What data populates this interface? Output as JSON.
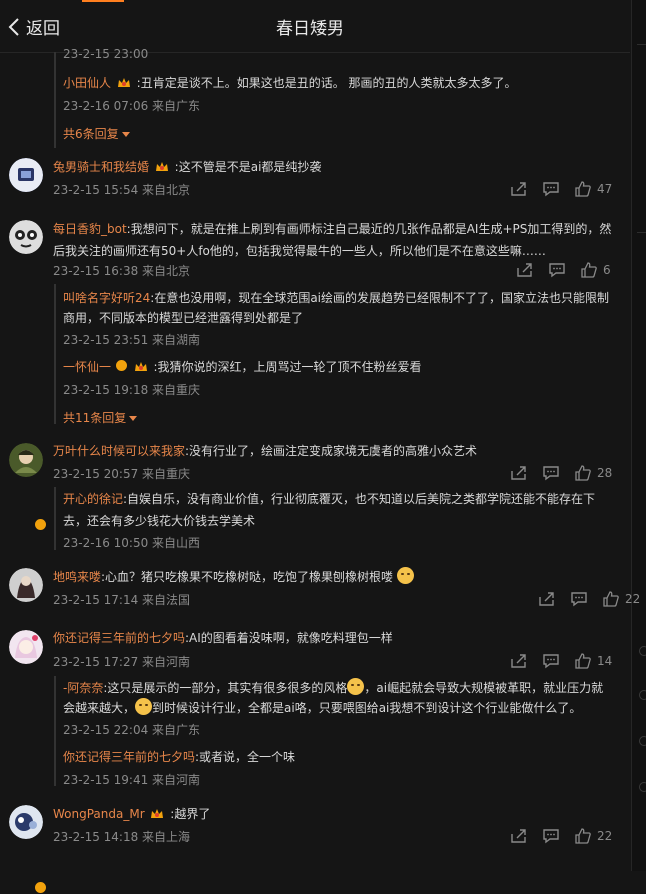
{
  "header": {
    "back_label": "返回",
    "title": "春日矮男"
  },
  "c0": {
    "meta": "23-2-15 23:00",
    "reply1": {
      "user": "小田仙人",
      "text": ":丑肯定是谈不上。如果这也是丑的话。 那画的丑的人类就太多太多了。",
      "meta": "23-2-16 07:06 来自广东"
    },
    "more": "共6条回复"
  },
  "c1": {
    "user": "兔男骑士和我结婚",
    "text": ":这不管是不是ai都是纯抄袭",
    "meta": "23-2-15 15:54 来自北京",
    "likes": "47"
  },
  "c2": {
    "user": "每日香豹_bot",
    "text1": ":我想问下，就是在推上刷到有画师标注自己最近的几张作品都是AI生成+PS加工得到的，然",
    "text2": "后我关注的画师还有50+人fo他的，包括我觉得最牛的一些人，所以他们是不在意这些嘛……",
    "meta": "23-2-15 16:38 来自北京",
    "likes": "6",
    "reply1": {
      "user": "叫啥名字好听24",
      "text1": ":在意也没用啊，现在全球范围ai绘画的发展趋势已经限制不了了，国家立法也只能限制",
      "text2": "商用，不同版本的模型已经泄露得到处都是了",
      "meta": "23-2-15 23:51 来自湖南"
    },
    "reply2": {
      "user": "一怀仙一",
      "text": ":我猜你说的深红，上周骂过一轮了顶不住粉丝爱看",
      "meta": "23-2-15 19:18 来自重庆"
    },
    "more": "共11条回复"
  },
  "c3": {
    "user": "万叶什么时候可以来我家",
    "text": ":没有行业了，绘画注定变成家境无虞者的高雅小众艺术",
    "meta": "23-2-15 20:57 来自重庆",
    "likes": "28",
    "reply1": {
      "user": "开心的徐记",
      "text1": ":自娱自乐，没有商业价值，行业彻底覆灭，也不知道以后美院之类都学院还能不能存在下",
      "text2": "去，还会有多少钱花大价钱去学美术",
      "meta": "23-2-16 10:50 来自山西"
    }
  },
  "c4": {
    "user": "地鸣来喽",
    "text": ":心血？猪只吃橡果不吃橡树哒，吃饱了橡果刨橡树根喽",
    "meta": "23-2-15 17:14 来自法国",
    "likes": "22"
  },
  "c5": {
    "user": "你还记得三年前的七夕吗",
    "text": ":AI的图看着没味啊，就像吃料理包一样",
    "meta": "23-2-15 17:27 来自河南",
    "likes": "14",
    "reply1": {
      "user": "-阿奈奈",
      "text1a": ":这只是展示的一部分，其实有很多很多的风格",
      "text1b": "，ai崛起就会导致大规模被革职，就业压力就",
      "text2a": "会越来越大，",
      "text2b": "到时候设计行业，全都是ai咯，只要喂图给ai我想不到设计这个行业能做什么了。",
      "meta": "23-2-15 22:04 来自广东"
    },
    "reply2": {
      "user": "你还记得三年前的七夕吗",
      "text": ":或者说，全一个味",
      "meta": "23-2-15 19:41 来自河南"
    }
  },
  "c6": {
    "user": "WongPanda_Mr",
    "text": ":越界了",
    "meta": "23-2-15 14:18 来自上海",
    "likes": "22"
  }
}
